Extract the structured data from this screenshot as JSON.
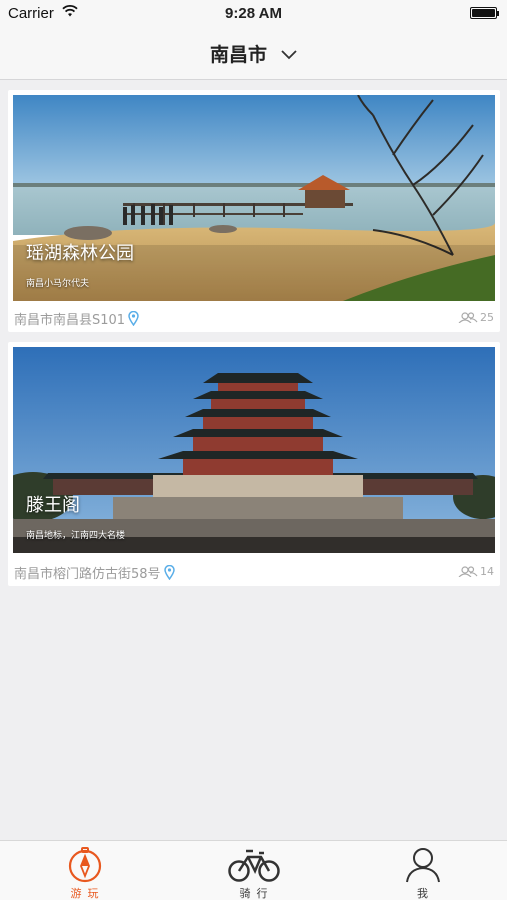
{
  "status_bar": {
    "carrier": "Carrier",
    "time": "9:28 AM"
  },
  "nav": {
    "title": "南昌市",
    "dropdown_icon": "chevron-down-icon"
  },
  "spots": [
    {
      "title": "瑶湖森林公园",
      "subtitle": "南昌小马尔代夫",
      "address": "南昌市南昌县S101",
      "count": "25"
    },
    {
      "title": "滕王阁",
      "subtitle": "南昌地标，江南四大名楼",
      "address": "南昌市榕门路仿古街58号",
      "count": "14"
    }
  ],
  "tabs": [
    {
      "label": "游玩",
      "icon": "compass-icon",
      "active": true
    },
    {
      "label": "骑行",
      "icon": "bicycle-icon",
      "active": false
    },
    {
      "label": "我",
      "icon": "person-icon",
      "active": false
    }
  ],
  "colors": {
    "accent": "#e8581f",
    "pin": "#5aaee8",
    "background": "#efeff1"
  }
}
